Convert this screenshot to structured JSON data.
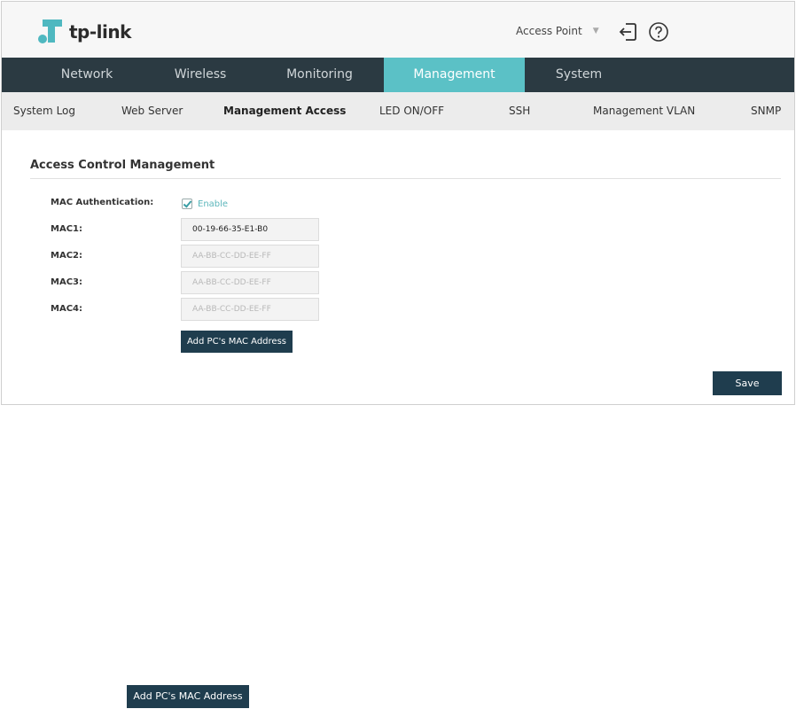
{
  "brand": {
    "logo_text": "tp-link"
  },
  "header": {
    "mode": "Access Point"
  },
  "mainnav": [
    "Network",
    "Wireless",
    "Monitoring",
    "Management",
    "System"
  ],
  "subnav": [
    "System Log",
    "Web Server",
    "Management Access",
    "LED ON/OFF",
    "SSH",
    "Management VLAN",
    "SNMP"
  ],
  "section": {
    "title": "Access Control Management"
  },
  "form": {
    "mac_auth_label": "MAC Authentication:",
    "enable_label": "Enable",
    "enable_checked": true,
    "mac1_label": "MAC1:",
    "mac1_value": "00-19-66-35-E1-B0",
    "mac2_label": "MAC2:",
    "mac2_placeholder": "AA-BB-CC-DD-EE-FF",
    "mac3_label": "MAC3:",
    "mac3_placeholder": "AA-BB-CC-DD-EE-FF",
    "mac4_label": "MAC4:",
    "mac4_placeholder": "AA-BB-CC-DD-EE-FF",
    "add_mac_label": "Add PC's MAC Address",
    "save_label": "Save"
  },
  "callout": {
    "add_mac_label": "Add PC's MAC Address"
  },
  "colors": {
    "nav_bg": "#2b3a42",
    "accent": "#5bc1c6",
    "button": "#1f3d4e"
  }
}
